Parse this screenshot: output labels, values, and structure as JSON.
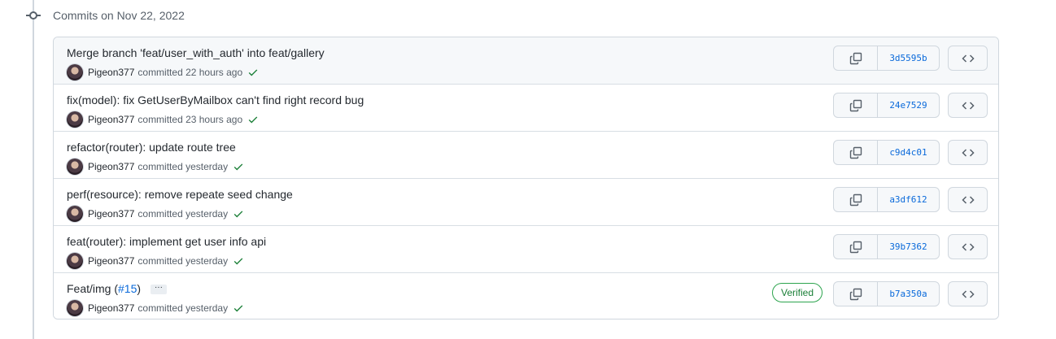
{
  "group_title": "Commits on Nov 22, 2022",
  "commits": [
    {
      "message": "Merge branch 'feat/user_with_auth' into feat/gallery",
      "author": "Pigeon377",
      "committed": "committed 22 hours ago",
      "sha": "3d5595b"
    },
    {
      "message": "fix(model): fix GetUserByMailbox can't find right record bug",
      "author": "Pigeon377",
      "committed": "committed 23 hours ago",
      "sha": "24e7529"
    },
    {
      "message": "refactor(router): update route tree",
      "author": "Pigeon377",
      "committed": "committed yesterday",
      "sha": "c9d4c01"
    },
    {
      "message": "perf(resource): remove repeate seed change",
      "author": "Pigeon377",
      "committed": "committed yesterday",
      "sha": "a3df612"
    },
    {
      "message": "feat(router): implement get user info api",
      "author": "Pigeon377",
      "committed": "committed yesterday",
      "sha": "39b7362"
    },
    {
      "message": "Feat/img (",
      "pr_link": "#15",
      "message_suffix": ")",
      "ellipsis": "···",
      "verified": "Verified",
      "author": "Pigeon377",
      "committed": "committed yesterday",
      "sha": "b7a350a"
    }
  ],
  "icons": {
    "timeline": "git-commit-icon",
    "copy": "copy-icon",
    "browse": "code-icon",
    "status": "check-icon"
  },
  "colors": {
    "link": "#0969da",
    "success": "#1a7f37",
    "border": "#d0d7de"
  }
}
